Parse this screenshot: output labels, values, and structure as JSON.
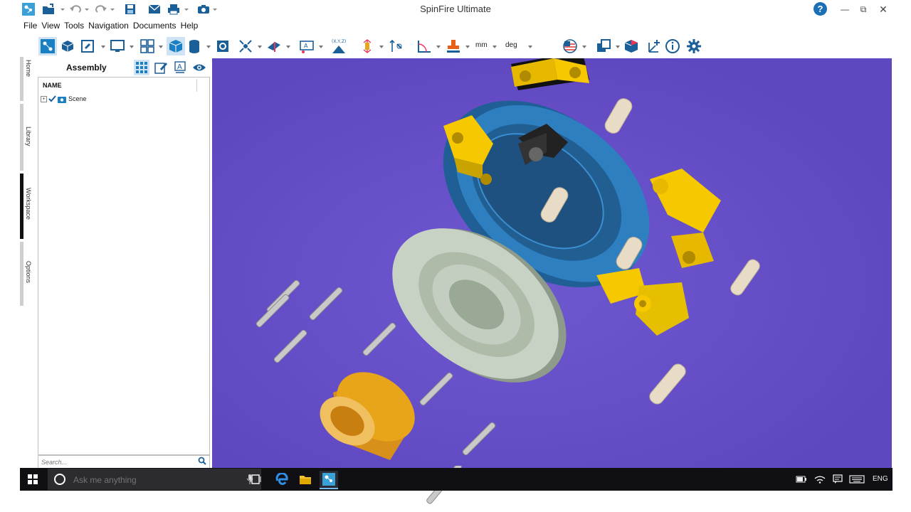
{
  "app": {
    "title": "SpinFire Ultimate"
  },
  "menu": [
    "File",
    "View",
    "Tools",
    "Navigation",
    "Documents",
    "Help"
  ],
  "toolbar": {
    "units_length": "mm",
    "units_angle": "deg",
    "axis_label": "(X,Y,Z)"
  },
  "side_tabs": [
    "Home",
    "Library",
    "Workspace",
    "Options"
  ],
  "panel": {
    "title": "Assembly",
    "column_header": "NAME",
    "tree": [
      {
        "label": "Scene",
        "checked": true
      }
    ],
    "search_placeholder": "Search..."
  },
  "taskbar": {
    "search_placeholder": "Ask me anything",
    "language": "ENG"
  },
  "colors": {
    "viewport_bg": "#6a52c9",
    "accent": "#1b6fb5",
    "part_blue": "#2e7fc0",
    "part_yellow": "#f5c800",
    "part_orange": "#e8a51a",
    "part_gray": "#c8d2c4"
  }
}
